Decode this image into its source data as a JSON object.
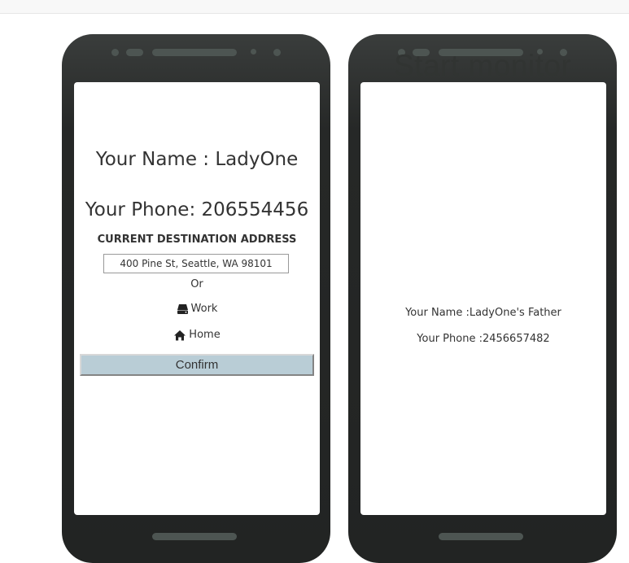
{
  "header": {
    "watermark_text": "Start monitor"
  },
  "user_phone": {
    "name_line": "Your Name : LadyOne",
    "phone_line": "Your Phone: 206554456",
    "destination_label": "CURRENT DESTINATION ADDRESS",
    "address_value": "400 Pine St, Seattle, WA 98101",
    "or_text": "Or",
    "options": [
      {
        "label": "Work",
        "icon": "hard-drive-icon"
      },
      {
        "label": "Home",
        "icon": "home-icon"
      }
    ],
    "confirm_label": "Confirm"
  },
  "monitor_phone": {
    "name_line": "Your Name :LadyOne's Father",
    "phone_line": "Your Phone :2456657482"
  },
  "colors": {
    "phone_body": "#262827",
    "phone_accent": "#4d5552",
    "confirm_bg": "#b9cdd6",
    "text": "#333333"
  }
}
